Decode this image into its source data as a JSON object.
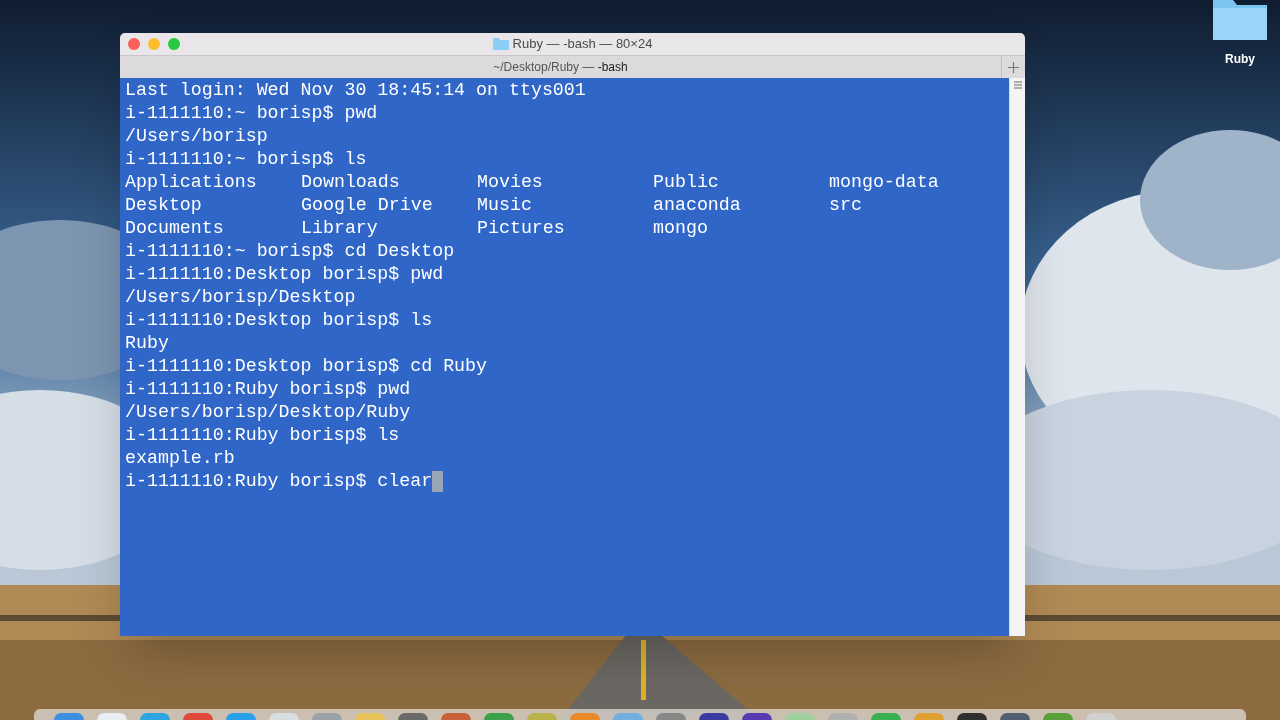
{
  "desktop": {
    "icons": [
      {
        "label": "Ruby"
      }
    ]
  },
  "window": {
    "title": "Ruby — -bash — 80×24",
    "tabs": [
      {
        "label": "~/Desktop/Ruby — ",
        "process": "-bash",
        "selected": true
      }
    ],
    "terminal": {
      "lines": [
        {
          "kind": "text",
          "text": "Last login: Wed Nov 30 18:45:14 on ttys001"
        },
        {
          "kind": "text",
          "text": "i-1111110:~ borisp$ pwd"
        },
        {
          "kind": "text",
          "text": "/Users/borisp"
        },
        {
          "kind": "text",
          "text": "i-1111110:~ borisp$ ls"
        },
        {
          "kind": "listing",
          "columns": [
            "Applications",
            "Downloads",
            "Movies",
            "Public",
            "mongo-data"
          ]
        },
        {
          "kind": "listing",
          "columns": [
            "Desktop",
            "Google Drive",
            "Music",
            "anaconda",
            "src"
          ]
        },
        {
          "kind": "listing",
          "columns": [
            "Documents",
            "Library",
            "Pictures",
            "mongo"
          ]
        },
        {
          "kind": "text",
          "text": "i-1111110:~ borisp$ cd Desktop"
        },
        {
          "kind": "text",
          "text": "i-1111110:Desktop borisp$ pwd"
        },
        {
          "kind": "text",
          "text": "/Users/borisp/Desktop"
        },
        {
          "kind": "text",
          "text": "i-1111110:Desktop borisp$ ls"
        },
        {
          "kind": "text",
          "text": "Ruby"
        },
        {
          "kind": "text",
          "text": "i-1111110:Desktop borisp$ cd Ruby"
        },
        {
          "kind": "text",
          "text": "i-1111110:Ruby borisp$ pwd"
        },
        {
          "kind": "text",
          "text": "/Users/borisp/Desktop/Ruby"
        },
        {
          "kind": "text",
          "text": "i-1111110:Ruby borisp$ ls"
        },
        {
          "kind": "text",
          "text": "example.rb"
        },
        {
          "kind": "text",
          "text": "i-1111110:Ruby borisp$ clear",
          "cursor": true
        }
      ]
    }
  }
}
